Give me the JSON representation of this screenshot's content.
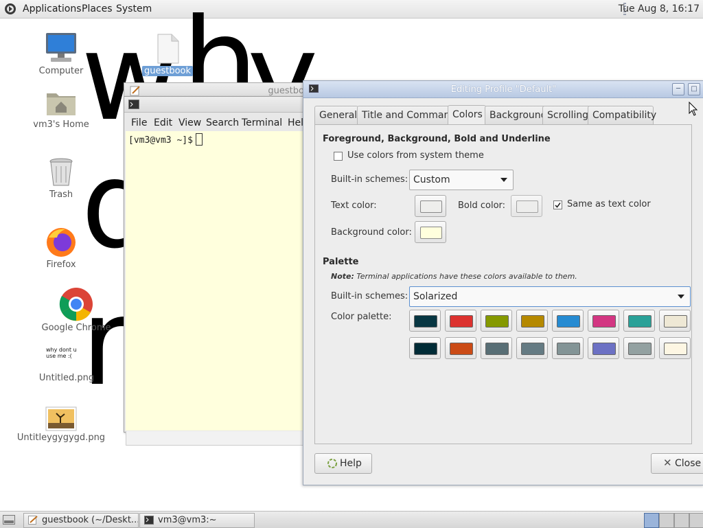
{
  "top_panel": {
    "menus": [
      "Applications",
      "Places",
      "System"
    ],
    "clock": "Tue Aug  8, 16:17"
  },
  "wallpaper": {
    "letters": [
      "w",
      "h",
      "y",
      "d",
      "r"
    ]
  },
  "desktop": {
    "icons": [
      {
        "label": "Computer",
        "icon": "computer-icon"
      },
      {
        "label": "guestbook",
        "icon": "file-icon"
      },
      {
        "label": "vm3's Home",
        "icon": "home-folder-icon"
      },
      {
        "label": "Trash",
        "icon": "trash-icon"
      },
      {
        "label": "Firefox",
        "icon": "firefox-icon"
      },
      {
        "label": "Google Chrome",
        "icon": "chrome-icon"
      },
      {
        "label": "Untitled.png",
        "icon": "image-icon",
        "thumb_text": "why dont u use me :("
      },
      {
        "label": "Untitleygygygd.png",
        "icon": "image-icon"
      }
    ]
  },
  "gedit_window": {
    "title": "guestbo"
  },
  "terminal": {
    "menus": [
      "File",
      "Edit",
      "View",
      "Search",
      "Terminal",
      "Help"
    ],
    "prompt": "[vm3@vm3 ~]$"
  },
  "dialog": {
    "title": "Editing Profile \"Default\"",
    "tabs": [
      "General",
      "Title and Command",
      "Colors",
      "Background",
      "Scrolling",
      "Compatibility"
    ],
    "active_tab": "Colors",
    "fg_section": "Foreground, Background, Bold and Underline",
    "use_system_colors": "Use colors from system theme",
    "builtin_label": "Built-in schemes:",
    "builtin_value": "Custom",
    "text_color_label": "Text color:",
    "bold_color_label": "Bold color:",
    "same_as_text": "Same as text color",
    "bg_color_label": "Background color:",
    "palette_section": "Palette",
    "note_bold": "Note:",
    "note_text": " Terminal applications have these colors available to them.",
    "palette_builtin_label": "Built-in schemes:",
    "palette_builtin_value": "Solarized",
    "color_palette_label": "Color palette:",
    "help_label": "Help",
    "close_label": "Close",
    "colors": {
      "text": "#eeeeec",
      "bold": "#eeeeec",
      "background": "#ffffdd",
      "palette": [
        "#073642",
        "#dc322f",
        "#859900",
        "#b58900",
        "#268bd2",
        "#d33682",
        "#2aa198",
        "#eee8d5",
        "#002b36",
        "#cb4b16",
        "#586e75",
        "#657b83",
        "#839496",
        "#6c71c4",
        "#93a1a1",
        "#fdf6e3"
      ]
    }
  },
  "taskbar": {
    "tasks": [
      {
        "label": "guestbook (~/Deskt..."
      },
      {
        "label": "vm3@vm3:~"
      }
    ]
  }
}
